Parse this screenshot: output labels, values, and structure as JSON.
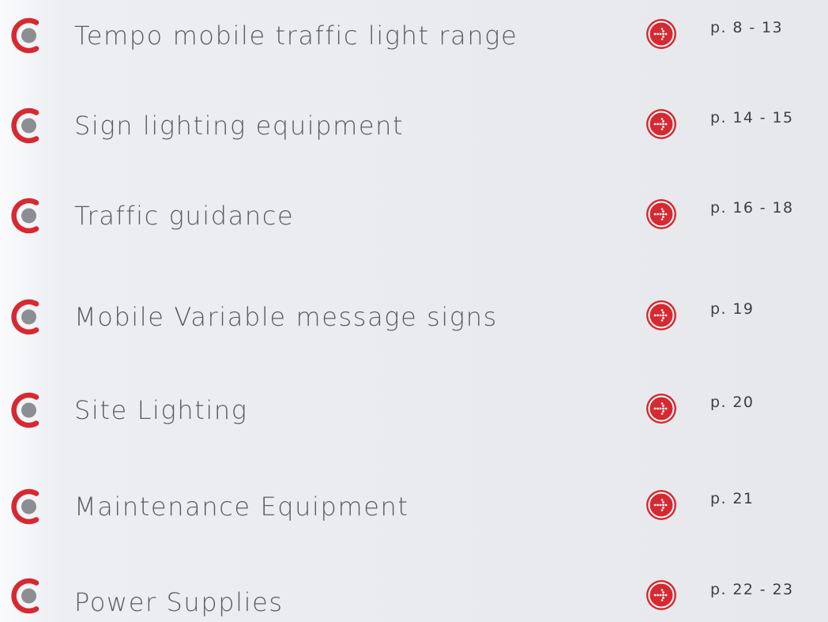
{
  "colors": {
    "accent_red": "#d62931",
    "bullet_grey": "#8c8e94",
    "label_text": "#5a5c64",
    "page_text": "#3c3e46"
  },
  "icons": {
    "bullet": "c-ring-bullet-icon",
    "go": "dotted-arrow-circle-icon"
  },
  "toc": {
    "items": [
      {
        "label": "Tempo mobile traffic light range",
        "pages": "p. 8 - 13"
      },
      {
        "label": "Sign lighting equipment",
        "pages": "p. 14 - 15"
      },
      {
        "label": "Traffic guidance",
        "pages": "p. 16 - 18"
      },
      {
        "label": "Mobile Variable message signs",
        "pages": "p. 19"
      },
      {
        "label": "Site Lighting",
        "pages": "p. 20"
      },
      {
        "label": "Maintenance Equipment",
        "pages": "p. 21"
      },
      {
        "label": "Power Supplies",
        "pages": "p. 22 - 23"
      }
    ]
  }
}
